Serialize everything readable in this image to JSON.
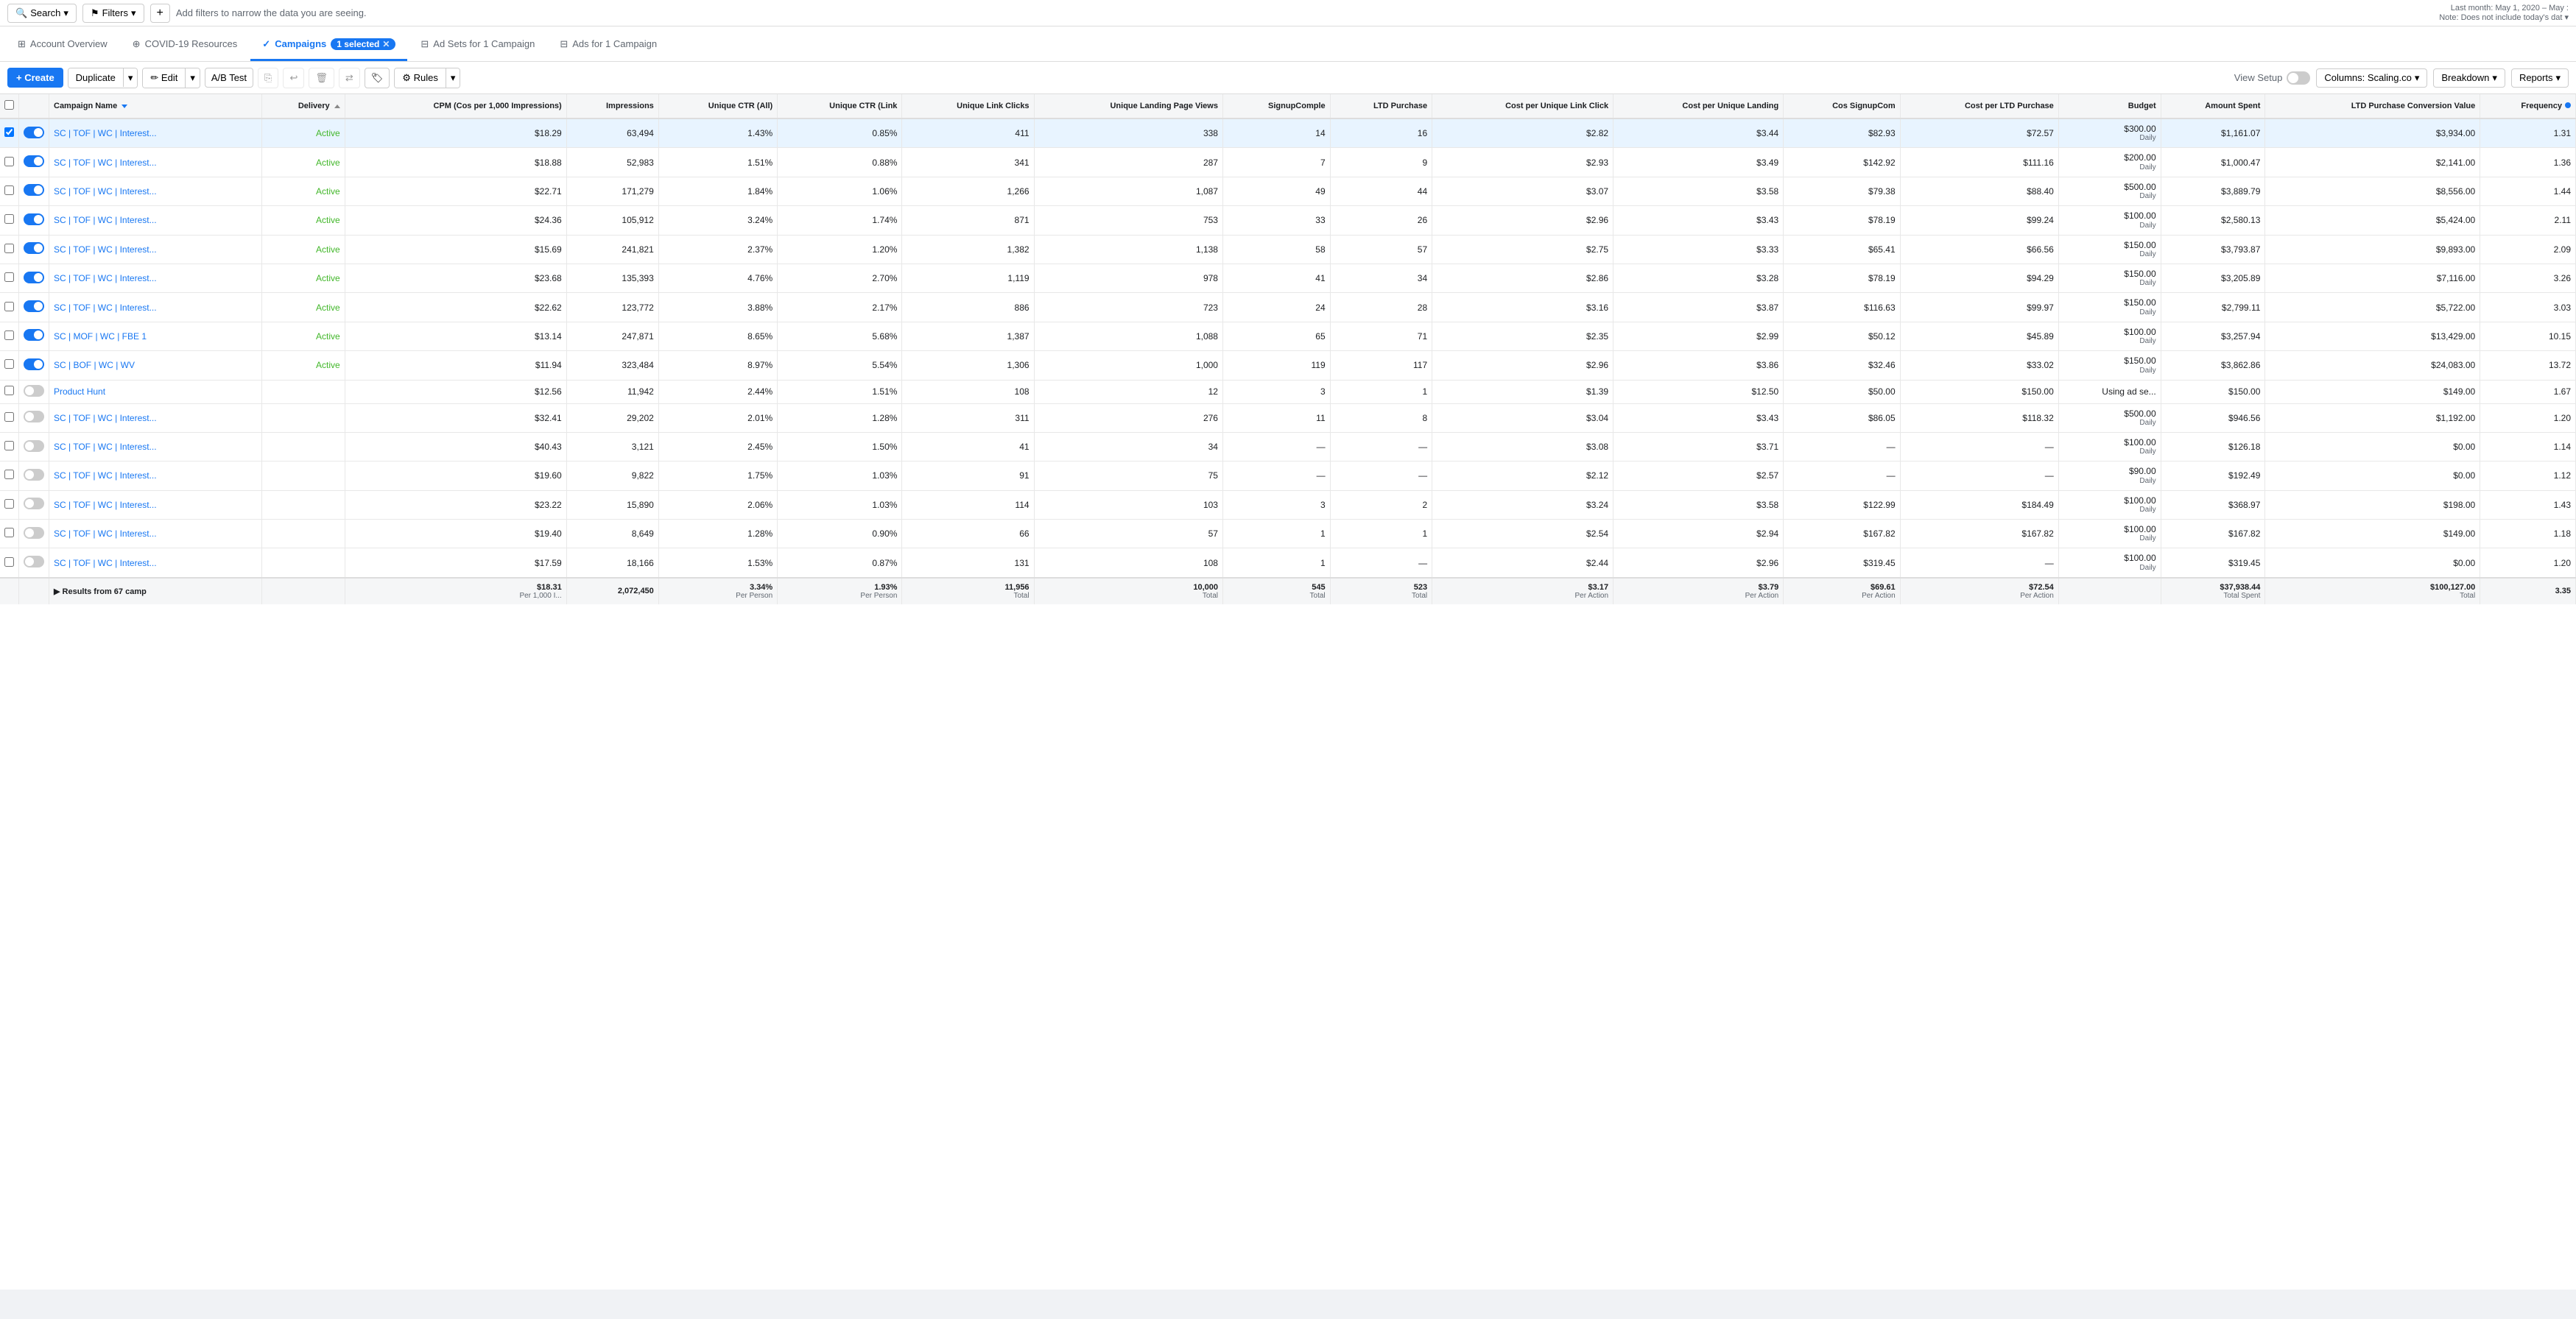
{
  "topbar": {
    "search_label": "Search",
    "filters_label": "Filters",
    "filter_hint": "Add filters to narrow the data you are seeing.",
    "date_range": "Last month: May 1, 2020 – May :",
    "date_note": "Note: Does not include today's dat ▾"
  },
  "nav": {
    "account_overview": "Account Overview",
    "covid": "COVID-19 Resources",
    "campaigns": "Campaigns",
    "selected_count": "1 selected",
    "ad_sets": "Ad Sets for 1 Campaign",
    "ads": "Ads for 1 Campaign"
  },
  "toolbar": {
    "create": "+ Create",
    "duplicate": "Duplicate",
    "edit": "Edit",
    "ab_test": "A/B Test",
    "rules": "Rules",
    "view_setup": "View Setup",
    "columns_label": "Columns: Scaling.co",
    "breakdown": "Breakdown",
    "reports": "Reports"
  },
  "columns": [
    "Campaign Name",
    "Delivery",
    "CPM (Cos per 1,000 Impressions)",
    "Impressions",
    "Unique CTR (All)",
    "Unique CTR (Link",
    "Unique Link Clicks",
    "Unique Landing Page Views",
    "SignupComple",
    "LTD Purchase",
    "Cost per Unique Link Click",
    "Cost per Unique Landing",
    "Cos SignupCom",
    "Cost per LTD Purchase",
    "Budget",
    "Amount Spent",
    "LTD Purchase Conversion Value",
    "Frequency"
  ],
  "rows": [
    {
      "name": "SC | TOF | WC | Interest...",
      "status": "Active",
      "cpm": "$18.29",
      "impressions": "63,494",
      "uctr_all": "1.43%",
      "uctr_link": "0.85%",
      "ulc": "411",
      "ulpv": "338",
      "signup": "14",
      "ltd": "16",
      "cost_ulc": "$2.82",
      "cost_ul": "$3.44",
      "cos_signup": "$82.93",
      "cost_ltd": "$72.57",
      "budget": "$300.00",
      "budget_period": "Daily",
      "amount_spent": "$1,161.07",
      "ltd_value": "$3,934.00",
      "freq": "1.31",
      "on": true,
      "selected": true
    },
    {
      "name": "SC | TOF | WC | Interest...",
      "status": "Active",
      "cpm": "$18.88",
      "impressions": "52,983",
      "uctr_all": "1.51%",
      "uctr_link": "0.88%",
      "ulc": "341",
      "ulpv": "287",
      "signup": "7",
      "ltd": "9",
      "cost_ulc": "$2.93",
      "cost_ul": "$3.49",
      "cos_signup": "$142.92",
      "cost_ltd": "$111.16",
      "budget": "$200.00",
      "budget_period": "Daily",
      "amount_spent": "$1,000.47",
      "ltd_value": "$2,141.00",
      "freq": "1.36",
      "on": true,
      "selected": false
    },
    {
      "name": "SC | TOF | WC | Interest...",
      "status": "Active",
      "cpm": "$22.71",
      "impressions": "171,279",
      "uctr_all": "1.84%",
      "uctr_link": "1.06%",
      "ulc": "1,266",
      "ulpv": "1,087",
      "signup": "49",
      "ltd": "44",
      "cost_ulc": "$3.07",
      "cost_ul": "$3.58",
      "cos_signup": "$79.38",
      "cost_ltd": "$88.40",
      "budget": "$500.00",
      "budget_period": "Daily",
      "amount_spent": "$3,889.79",
      "ltd_value": "$8,556.00",
      "freq": "1.44",
      "on": true,
      "selected": false
    },
    {
      "name": "SC | TOF | WC | Interest...",
      "status": "Active",
      "cpm": "$24.36",
      "impressions": "105,912",
      "uctr_all": "3.24%",
      "uctr_link": "1.74%",
      "ulc": "871",
      "ulpv": "753",
      "signup": "33",
      "ltd": "26",
      "cost_ulc": "$2.96",
      "cost_ul": "$3.43",
      "cos_signup": "$78.19",
      "cost_ltd": "$99.24",
      "budget": "$100.00",
      "budget_period": "Daily",
      "amount_spent": "$2,580.13",
      "ltd_value": "$5,424.00",
      "freq": "2.11",
      "on": true,
      "selected": false
    },
    {
      "name": "SC | TOF | WC | Interest...",
      "status": "Active",
      "cpm": "$15.69",
      "impressions": "241,821",
      "uctr_all": "2.37%",
      "uctr_link": "1.20%",
      "ulc": "1,382",
      "ulpv": "1,138",
      "signup": "58",
      "ltd": "57",
      "cost_ulc": "$2.75",
      "cost_ul": "$3.33",
      "cos_signup": "$65.41",
      "cost_ltd": "$66.56",
      "budget": "$150.00",
      "budget_period": "Daily",
      "amount_spent": "$3,793.87",
      "ltd_value": "$9,893.00",
      "freq": "2.09",
      "on": true,
      "selected": false
    },
    {
      "name": "SC | TOF | WC | Interest...",
      "status": "Active",
      "cpm": "$23.68",
      "impressions": "135,393",
      "uctr_all": "4.76%",
      "uctr_link": "2.70%",
      "ulc": "1,119",
      "ulpv": "978",
      "signup": "41",
      "ltd": "34",
      "cost_ulc": "$2.86",
      "cost_ul": "$3.28",
      "cos_signup": "$78.19",
      "cost_ltd": "$94.29",
      "budget": "$150.00",
      "budget_period": "Daily",
      "amount_spent": "$3,205.89",
      "ltd_value": "$7,116.00",
      "freq": "3.26",
      "on": true,
      "selected": false
    },
    {
      "name": "SC | TOF | WC | Interest...",
      "status": "Active",
      "cpm": "$22.62",
      "impressions": "123,772",
      "uctr_all": "3.88%",
      "uctr_link": "2.17%",
      "ulc": "886",
      "ulpv": "723",
      "signup": "24",
      "ltd": "28",
      "cost_ulc": "$3.16",
      "cost_ul": "$3.87",
      "cos_signup": "$116.63",
      "cost_ltd": "$99.97",
      "budget": "$150.00",
      "budget_period": "Daily",
      "amount_spent": "$2,799.11",
      "ltd_value": "$5,722.00",
      "freq": "3.03",
      "on": true,
      "selected": false
    },
    {
      "name": "SC | MOF | WC | FBE 1",
      "status": "Active",
      "cpm": "$13.14",
      "impressions": "247,871",
      "uctr_all": "8.65%",
      "uctr_link": "5.68%",
      "ulc": "1,387",
      "ulpv": "1,088",
      "signup": "65",
      "ltd": "71",
      "cost_ulc": "$2.35",
      "cost_ul": "$2.99",
      "cos_signup": "$50.12",
      "cost_ltd": "$45.89",
      "budget": "$100.00",
      "budget_period": "Daily",
      "amount_spent": "$3,257.94",
      "ltd_value": "$13,429.00",
      "freq": "10.15",
      "on": true,
      "selected": false
    },
    {
      "name": "SC | BOF | WC | WV",
      "status": "Active",
      "cpm": "$11.94",
      "impressions": "323,484",
      "uctr_all": "8.97%",
      "uctr_link": "5.54%",
      "ulc": "1,306",
      "ulpv": "1,000",
      "signup": "119",
      "ltd": "117",
      "cost_ulc": "$2.96",
      "cost_ul": "$3.86",
      "cos_signup": "$32.46",
      "cost_ltd": "$33.02",
      "budget": "$150.00",
      "budget_period": "Daily",
      "amount_spent": "$3,862.86",
      "ltd_value": "$24,083.00",
      "freq": "13.72",
      "on": true,
      "selected": false
    },
    {
      "name": "Product Hunt",
      "status": "",
      "cpm": "$12.56",
      "impressions": "11,942",
      "uctr_all": "2.44%",
      "uctr_link": "1.51%",
      "ulc": "108",
      "ulpv": "12",
      "signup": "3",
      "ltd": "1",
      "cost_ulc": "$1.39",
      "cost_ul": "$12.50",
      "cos_signup": "$50.00",
      "cost_ltd": "$150.00",
      "budget": "Using ad se...",
      "budget_period": "",
      "amount_spent": "$150.00",
      "ltd_value": "$149.00",
      "freq": "1.67",
      "on": false,
      "selected": false
    },
    {
      "name": "SC | TOF | WC | Interest...",
      "status": "",
      "cpm": "$32.41",
      "impressions": "29,202",
      "uctr_all": "2.01%",
      "uctr_link": "1.28%",
      "ulc": "311",
      "ulpv": "276",
      "signup": "11",
      "ltd": "8",
      "cost_ulc": "$3.04",
      "cost_ul": "$3.43",
      "cos_signup": "$86.05",
      "cost_ltd": "$118.32",
      "budget": "$500.00",
      "budget_period": "Daily",
      "amount_spent": "$946.56",
      "ltd_value": "$1,192.00",
      "freq": "1.20",
      "on": false,
      "selected": false
    },
    {
      "name": "SC | TOF | WC | Interest...",
      "status": "",
      "cpm": "$40.43",
      "impressions": "3,121",
      "uctr_all": "2.45%",
      "uctr_link": "1.50%",
      "ulc": "41",
      "ulpv": "34",
      "signup": "—",
      "ltd": "—",
      "cost_ulc": "$3.08",
      "cost_ul": "$3.71",
      "cos_signup": "—",
      "cost_ltd": "—",
      "budget": "$100.00",
      "budget_period": "Daily",
      "amount_spent": "$126.18",
      "ltd_value": "$0.00",
      "freq": "1.14",
      "on": false,
      "selected": false
    },
    {
      "name": "SC | TOF | WC | Interest...",
      "status": "",
      "cpm": "$19.60",
      "impressions": "9,822",
      "uctr_all": "1.75%",
      "uctr_link": "1.03%",
      "ulc": "91",
      "ulpv": "75",
      "signup": "—",
      "ltd": "—",
      "cost_ulc": "$2.12",
      "cost_ul": "$2.57",
      "cos_signup": "—",
      "cost_ltd": "—",
      "budget": "$90.00",
      "budget_period": "Daily",
      "amount_spent": "$192.49",
      "ltd_value": "$0.00",
      "freq": "1.12",
      "on": false,
      "selected": false
    },
    {
      "name": "SC | TOF | WC | Interest...",
      "status": "",
      "cpm": "$23.22",
      "impressions": "15,890",
      "uctr_all": "2.06%",
      "uctr_link": "1.03%",
      "ulc": "114",
      "ulpv": "103",
      "signup": "3",
      "ltd": "2",
      "cost_ulc": "$3.24",
      "cost_ul": "$3.58",
      "cos_signup": "$122.99",
      "cost_ltd": "$184.49",
      "budget": "$100.00",
      "budget_period": "Daily",
      "amount_spent": "$368.97",
      "ltd_value": "$198.00",
      "freq": "1.43",
      "on": false,
      "selected": false
    },
    {
      "name": "SC | TOF | WC | Interest...",
      "status": "",
      "cpm": "$19.40",
      "impressions": "8,649",
      "uctr_all": "1.28%",
      "uctr_link": "0.90%",
      "ulc": "66",
      "ulpv": "57",
      "signup": "1",
      "ltd": "1",
      "cost_ulc": "$2.54",
      "cost_ul": "$2.94",
      "cos_signup": "$167.82",
      "cost_ltd": "$167.82",
      "budget": "$100.00",
      "budget_period": "Daily",
      "amount_spent": "$167.82",
      "ltd_value": "$149.00",
      "freq": "1.18",
      "on": false,
      "selected": false
    },
    {
      "name": "SC | TOF | WC | Interest...",
      "status": "",
      "cpm": "$17.59",
      "impressions": "18,166",
      "uctr_all": "1.53%",
      "uctr_link": "0.87%",
      "ulc": "131",
      "ulpv": "108",
      "signup": "1",
      "ltd": "—",
      "cost_ulc": "$2.44",
      "cost_ul": "$2.96",
      "cos_signup": "$319.45",
      "cost_ltd": "—",
      "budget": "$100.00",
      "budget_period": "Daily",
      "amount_spent": "$319.45",
      "ltd_value": "$0.00",
      "freq": "1.20",
      "on": false,
      "selected": false
    }
  ],
  "footer": {
    "results_label": "▶ Results from 67 camp",
    "cpm": "$18.31",
    "cpm_sub": "Per 1,000 I...",
    "impressions": "2,072,450",
    "uctr_all": "3.34%",
    "uctr_all_sub": "Per Person",
    "uctr_link": "1.93%",
    "uctr_link_sub": "Per Person",
    "ulc": "11,956",
    "ulc_sub": "Total",
    "ulpv": "10,000",
    "ulpv_sub": "Total",
    "signup": "545",
    "signup_sub": "Total",
    "ltd": "523",
    "ltd_sub": "Total",
    "cost_ulc": "$3.17",
    "cost_ulc_sub": "Per Action",
    "cost_ul": "$3.79",
    "cost_ul_sub": "Per Action",
    "cos_signup": "$69.61",
    "cos_signup_sub": "Per Action",
    "cost_ltd": "$72.54",
    "cost_ltd_sub": "Per Action",
    "budget": "",
    "amount_spent": "$37,938.44",
    "amount_sub": "Total Spent",
    "ltd_value": "$100,127.00",
    "ltd_value_sub": "Total",
    "freq": "3.35"
  }
}
